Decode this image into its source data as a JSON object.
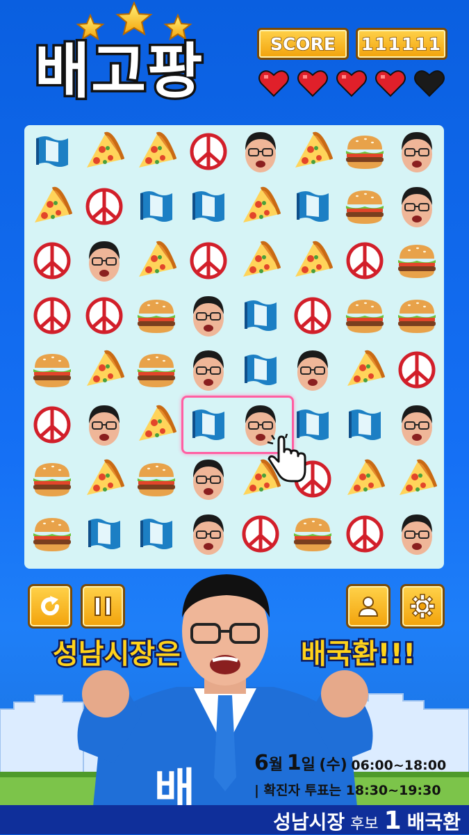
{
  "header": {
    "title": "배고팡",
    "score_label": "SCORE",
    "score_value": "111111",
    "lives": {
      "full": 4,
      "total": 5
    },
    "stars": 3
  },
  "board": {
    "rows": 8,
    "cols": 8,
    "tiles": [
      [
        "flag",
        "pizza",
        "pizza",
        "peace",
        "face",
        "pizza",
        "burger",
        "face"
      ],
      [
        "pizza",
        "peace",
        "flag",
        "flag",
        "pizza",
        "flag",
        "burger",
        "face"
      ],
      [
        "peace",
        "face",
        "pizza",
        "peace",
        "pizza",
        "pizza",
        "peace",
        "burger"
      ],
      [
        "peace",
        "peace",
        "burger",
        "face",
        "flag",
        "peace",
        "burger",
        "burger"
      ],
      [
        "burger",
        "pizza",
        "burger",
        "face",
        "flag",
        "face",
        "pizza",
        "peace"
      ],
      [
        "peace",
        "face",
        "pizza",
        "flag",
        "face",
        "flag",
        "flag",
        "face"
      ],
      [
        "burger",
        "pizza",
        "burger",
        "face",
        "pizza",
        "peace",
        "pizza",
        "pizza"
      ],
      [
        "burger",
        "flag",
        "flag",
        "face",
        "peace",
        "burger",
        "peace",
        "face"
      ]
    ],
    "selected": {
      "row": 5,
      "cols": [
        3,
        4
      ]
    }
  },
  "controls": {
    "restart_icon": "restart-icon",
    "pause_icon": "pause-icon",
    "profile_icon": "profile-icon",
    "settings_icon": "gear-icon"
  },
  "slogan": {
    "left": "성남시장은",
    "right": "배국환!!!"
  },
  "jacket_text": "배",
  "info": {
    "date_month": "6",
    "date_month_unit": "월",
    "date_day": "1",
    "date_day_unit": "일",
    "weekday": "(수)",
    "hours": "06:00~18:00",
    "covid_line": "| 확진자 투표는 18:30~19:30"
  },
  "bottom": {
    "role": "성남시장",
    "candidate_word": "후보",
    "number": "1",
    "name": "배국환"
  },
  "colors": {
    "background": "#1570f5",
    "board": "#d6f4f6",
    "gold": "#f2a20b",
    "slogan": "#ffd21a",
    "heart": "#e0202a",
    "bottom_bar": "#0f2f9a"
  }
}
